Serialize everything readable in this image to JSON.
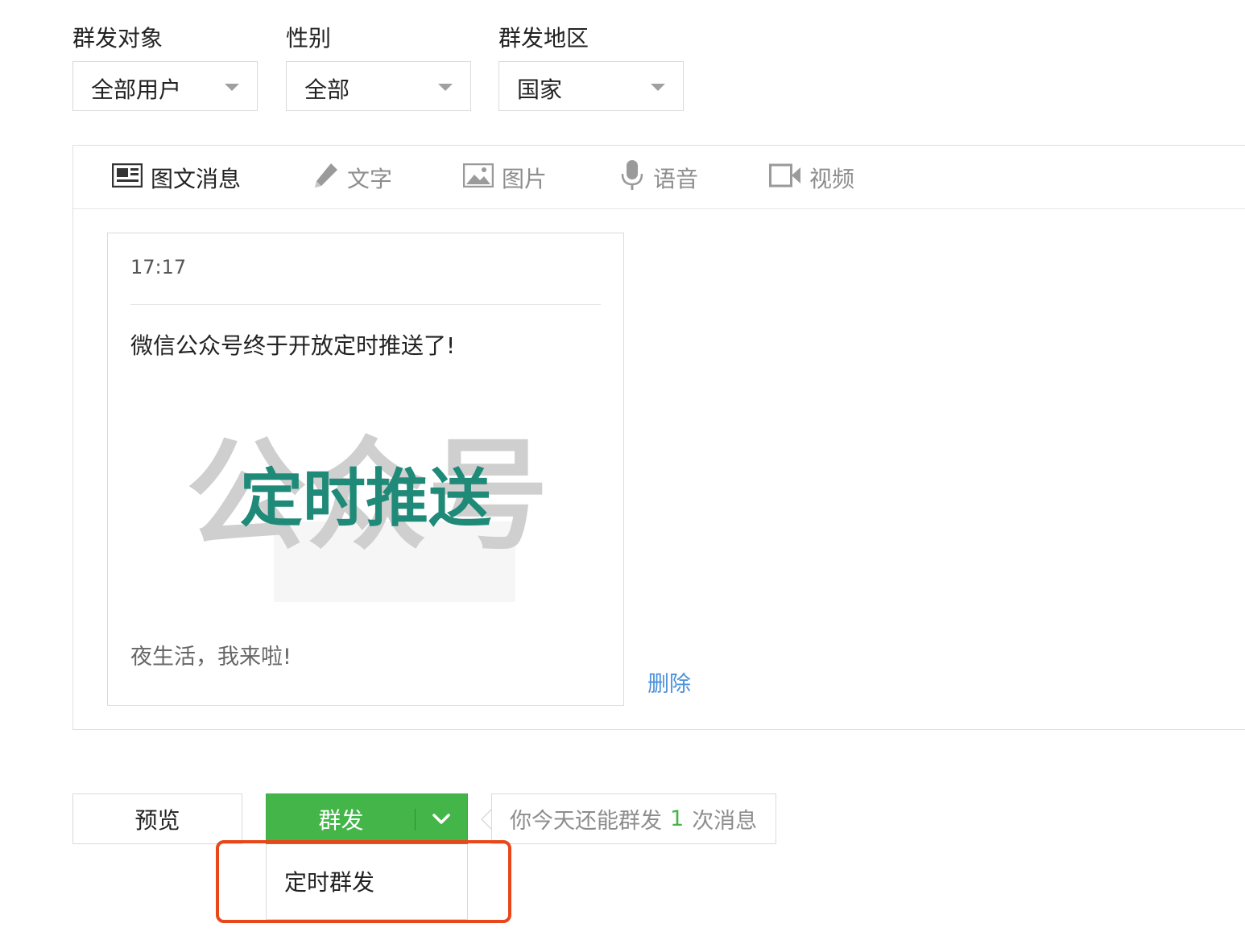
{
  "filters": {
    "target": {
      "label": "群发对象",
      "value": "全部用户"
    },
    "gender": {
      "label": "性别",
      "value": "全部"
    },
    "region": {
      "label": "群发地区",
      "value": "国家"
    }
  },
  "tabs": [
    {
      "label": "图文消息",
      "icon": "news-icon",
      "active": true
    },
    {
      "label": "文字",
      "icon": "pencil-icon"
    },
    {
      "label": "图片",
      "icon": "image-icon"
    },
    {
      "label": "语音",
      "icon": "microphone-icon"
    },
    {
      "label": "视频",
      "icon": "video-icon"
    }
  ],
  "article": {
    "time": "17:17",
    "title": "微信公众号终于开放定时推送了!",
    "cover_text": "定时推送",
    "cover_watermark": "公众号",
    "digest": "夜生活，我来啦!"
  },
  "actions": {
    "delete": "删除",
    "preview": "预览",
    "send": "群发",
    "hint_prefix": "你今天还能群发",
    "hint_count": "1",
    "hint_suffix": "次消息",
    "dropdown_item": "定时群发"
  },
  "colors": {
    "primary_green": "#44b549",
    "link_blue": "#4a90d9",
    "highlight_orange": "#e8471a",
    "cover_teal": "#1f8a78"
  }
}
